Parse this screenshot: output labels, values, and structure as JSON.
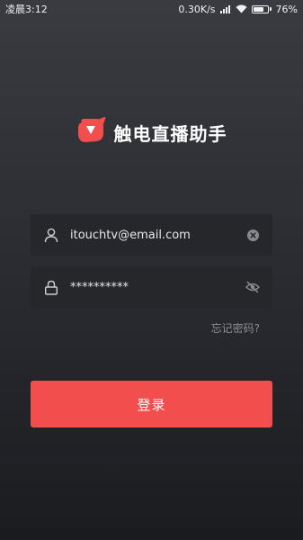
{
  "status_bar": {
    "time": "凌晨3:12",
    "network_speed": "0.30K/s",
    "battery_percent": "76%",
    "battery_level": 0.76,
    "icons": [
      "signal-icon",
      "wifi-icon",
      "battery-icon"
    ]
  },
  "brand": {
    "logo_icon": "app-logo-icon",
    "title": "触电直播助手",
    "accent_color": "#f24e4e"
  },
  "form": {
    "email": {
      "value": "itouchtv@email.com",
      "icon": "user-icon",
      "clear_icon": "clear-icon"
    },
    "password": {
      "value": "**********",
      "icon": "lock-icon",
      "toggle_icon": "eye-off-icon"
    },
    "forgot_label": "忘记密码?",
    "submit_label": "登录"
  },
  "colors": {
    "background_top": "#3a3b40",
    "background_bottom": "#1b1c20",
    "field_background": "#26272b",
    "button": "#f24e4e"
  }
}
